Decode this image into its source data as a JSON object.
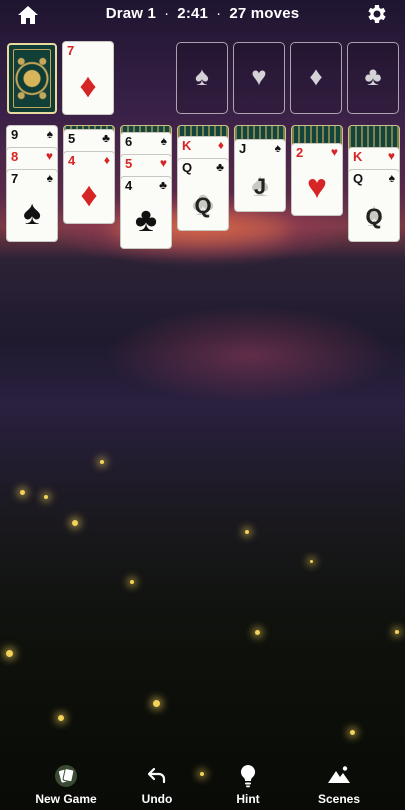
{
  "status": {
    "draw": "Draw 1",
    "separator": "·",
    "time": "2:41",
    "moves": "27 moves"
  },
  "icons": {
    "home": "home-icon",
    "settings": "gear-icon",
    "new_game": "cards-icon",
    "undo": "undo-arrow-icon",
    "hint": "lightbulb-icon",
    "scenes": "mountains-icon"
  },
  "colors": {
    "red_suit": "#d62525",
    "black_suit": "#111111",
    "card_face": "#fbfbf7",
    "card_back": "#13453e",
    "card_back_trim": "#d4b45a"
  },
  "waste": {
    "rank": "7",
    "suit": "♦"
  },
  "foundations": [
    {
      "suit": "♠",
      "name": "spades"
    },
    {
      "suit": "♥",
      "name": "hearts"
    },
    {
      "suit": "♦",
      "name": "diamonds"
    },
    {
      "suit": "♣",
      "name": "clubs"
    }
  ],
  "tableau": [
    {
      "hidden": 0,
      "cards": [
        {
          "rank": "9",
          "suit": "♠"
        },
        {
          "rank": "8",
          "suit": "♥"
        },
        {
          "rank": "7",
          "suit": "♠"
        }
      ]
    },
    {
      "hidden": 1,
      "cards": [
        {
          "rank": "5",
          "suit": "♣"
        },
        {
          "rank": "4",
          "suit": "♦"
        }
      ]
    },
    {
      "hidden": 2,
      "cards": [
        {
          "rank": "6",
          "suit": "♠"
        },
        {
          "rank": "5",
          "suit": "♥"
        },
        {
          "rank": "4",
          "suit": "♣"
        }
      ]
    },
    {
      "hidden": 3,
      "cards": [
        {
          "rank": "K",
          "suit": "♦"
        },
        {
          "rank": "Q",
          "suit": "♣"
        }
      ]
    },
    {
      "hidden": 4,
      "cards": [
        {
          "rank": "J",
          "suit": "♠"
        }
      ]
    },
    {
      "hidden": 5,
      "cards": [
        {
          "rank": "2",
          "suit": "♥"
        }
      ]
    },
    {
      "hidden": 6,
      "cards": [
        {
          "rank": "K",
          "suit": "♥"
        },
        {
          "rank": "Q",
          "suit": "♠"
        }
      ]
    }
  ],
  "nav": {
    "new_game": "New Game",
    "undo": "Undo",
    "hint": "Hint",
    "scenes": "Scenes"
  }
}
